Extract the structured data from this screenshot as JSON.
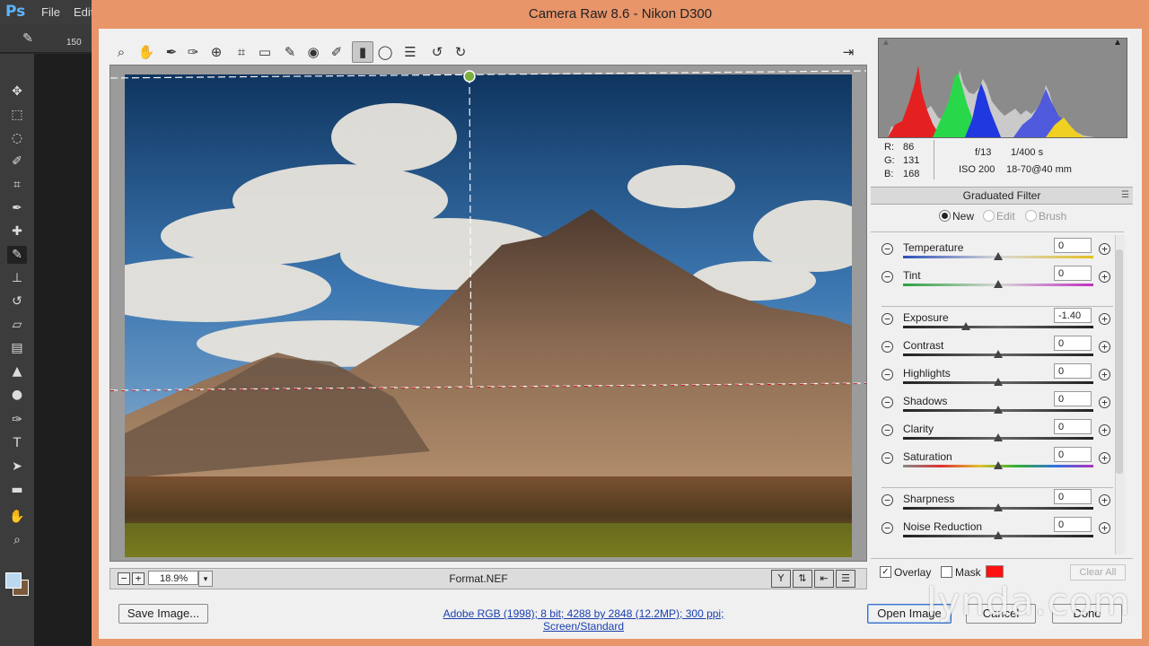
{
  "app": {
    "ps_logo": "Ps",
    "menus": [
      "File",
      "Edit"
    ],
    "brush_size": "150"
  },
  "dialog": {
    "title": "Camera Raw 8.6  -  Nikon D300"
  },
  "preview": {
    "zoom": "18.9%",
    "file_name": "Format.NEF"
  },
  "readout": {
    "r_label": "R:",
    "r": "86",
    "g_label": "G:",
    "g": "131",
    "b_label": "B:",
    "b": "168",
    "aperture": "f/13",
    "shutter": "1/400 s",
    "iso": "ISO 200",
    "lens": "18-70@40 mm"
  },
  "panel": {
    "title": "Graduated Filter",
    "modes": [
      {
        "label": "New",
        "selected": true,
        "enabled": true
      },
      {
        "label": "Edit",
        "selected": false,
        "enabled": false
      },
      {
        "label": "Brush",
        "selected": false,
        "enabled": false
      }
    ],
    "sliders": [
      {
        "label": "Temperature",
        "value": "0",
        "level": 0.5
      },
      {
        "label": "Tint",
        "value": "0",
        "level": 0.5
      },
      {
        "label": "Exposure",
        "value": "-1.40",
        "level": 0.33
      },
      {
        "label": "Contrast",
        "value": "0",
        "level": 0.5
      },
      {
        "label": "Highlights",
        "value": "0",
        "level": 0.5
      },
      {
        "label": "Shadows",
        "value": "0",
        "level": 0.5
      },
      {
        "label": "Clarity",
        "value": "0",
        "level": 0.5
      },
      {
        "label": "Saturation",
        "value": "0",
        "level": 0.5
      },
      {
        "label": "Sharpness",
        "value": "0",
        "level": 0.5
      },
      {
        "label": "Noise Reduction",
        "value": "0",
        "level": 0.5
      }
    ],
    "overlay_label": "Overlay",
    "overlay_checked": true,
    "mask_label": "Mask",
    "mask_checked": false,
    "mask_color": "#ff1010",
    "clear_all": "Clear All"
  },
  "footer": {
    "save_image": "Save Image...",
    "image_info": "Adobe RGB (1998); 8 bit; 4288 by 2848 (12.2MP); 300 ppi; Screen/Standard",
    "open_image": "Open Image",
    "cancel": "Cancel",
    "done": "Done"
  },
  "watermark": "lynda.com",
  "colors": {
    "dialog_frame": "#e8956a",
    "link": "#1a3fb0",
    "ps_accent": "#5cb3ff"
  }
}
